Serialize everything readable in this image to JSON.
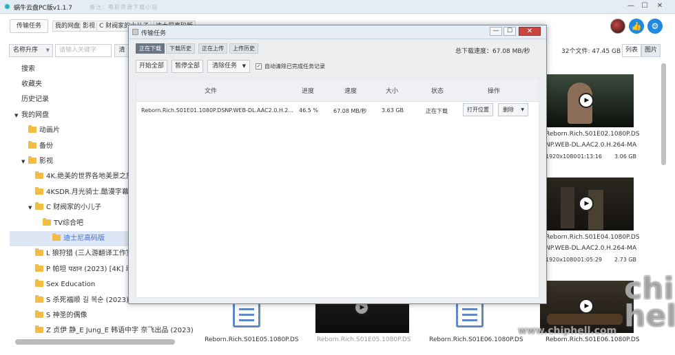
{
  "app": {
    "title": "蜗牛云盘PC版v1.1.7",
    "title_extra": "备注：电影资源下载小站"
  },
  "toolbar": {
    "transfer_button": "传输任务"
  },
  "breadcrumb": [
    "我的网盘",
    "影视",
    "C 财阀家的小儿子",
    "迪士尼高码版"
  ],
  "sort": {
    "selected": "名称升序",
    "search_placeholder": "请输入关键字",
    "clear": "清"
  },
  "nav": [
    {
      "label": "搜索",
      "level": 0
    },
    {
      "label": "收藏夹",
      "level": 0
    },
    {
      "label": "历史记录",
      "level": 0
    },
    {
      "label": "我的网盘",
      "level": 0,
      "expanded": true
    },
    {
      "label": "动画片",
      "level": 1
    },
    {
      "label": "备份",
      "level": 1
    },
    {
      "label": "影视",
      "level": 1,
      "expanded": true
    },
    {
      "label": "4K.绝美的世界各地美景之旅",
      "level": 2
    },
    {
      "label": "4KSDR.月光骑士.酷漫字幕组",
      "level": 2
    },
    {
      "label": "C 财阀家的小儿子",
      "level": 2,
      "expanded": true
    },
    {
      "label": "TV综合吧",
      "level": 3
    },
    {
      "label": "迪士尼高码版",
      "level": 3,
      "selected": true
    },
    {
      "label": "L 狼狩猎 (三人游翻译工作室)",
      "level": 2
    },
    {
      "label": "P 帕坦 पठान (2023) [4K] 动作",
      "level": 2
    },
    {
      "label": "Sex Education",
      "level": 2
    },
    {
      "label": "S 杀死福顺 길 복순 (2023) 动作",
      "level": 2
    },
    {
      "label": "S 神圣的偶像",
      "level": 2
    },
    {
      "label": "Z 贞伊 静_E Jung_E 韩语中字 奈飞出品 (2023)",
      "level": 2
    }
  ],
  "main": {
    "count": "32个文件: 47.45 GB",
    "view_list": "列表",
    "view_pic": "图片",
    "files": [
      {
        "name1": "Reborn.Rich.S01E02.1080P.DS",
        "name2": "NP.WEB-DL.AAC2.0.H.264-MA",
        "res": "1920x1080",
        "duration": "01:13:16",
        "size": "3.06 GB"
      },
      {
        "name1": "Reborn.Rich.S01E04.1080P.DS",
        "name2": "NP.WEB-DL.AAC2.0.H.264-MA",
        "res": "1920x1080",
        "duration": "01:05:29",
        "size": "2.73 GB"
      },
      {
        "name1": "Reborn.Rich.S01E05.1080P.DS"
      },
      {
        "name1": "Reborn.Rich.S01E05.1080P.DS"
      },
      {
        "name1": "Reborn.Rich.S01E06.1080P.DS"
      },
      {
        "name1": "Reborn.Rich.S01E06.1080P.DS"
      }
    ]
  },
  "dialog": {
    "title": "传输任务",
    "tabs": [
      "正在下载",
      "下载历史",
      "正在上传",
      "上传历史"
    ],
    "speed": "总下载速度：67.08 MB/秒",
    "buttons": {
      "start_all": "开始全部",
      "pause_all": "暂停全部",
      "clear_tasks": "清除任务",
      "auto_clear": "自动清除已完成任务记录"
    },
    "columns": [
      "文件",
      "进度",
      "速度",
      "大小",
      "状态",
      "操作"
    ],
    "rows": [
      {
        "file": "Reborn.Rich.S01E01.1080P.DSNP.WEB-DL.AAC2.0.H.2...",
        "progress": "46.5 %",
        "speed": "67.08 MB/秒",
        "size": "3.63 GB",
        "status": "正在下载",
        "open": "打开位置",
        "delete": "删除"
      }
    ]
  },
  "watermark": {
    "big": "chip hell",
    "url": "www.chiphell.com"
  }
}
